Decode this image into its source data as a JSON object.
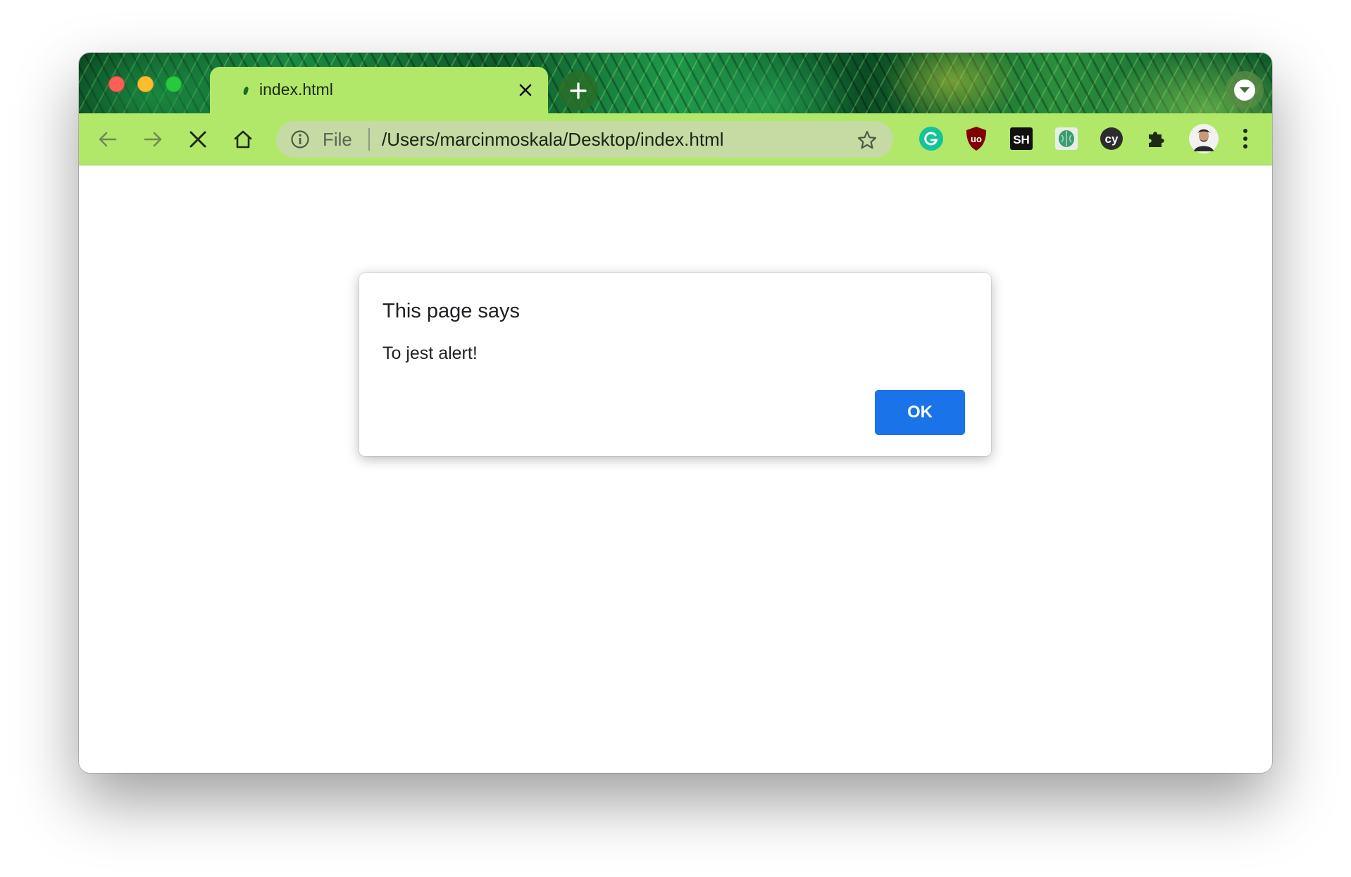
{
  "tab": {
    "title": "index.html",
    "favicon": "leaf-favicon-icon"
  },
  "toolbar": {
    "back_icon": "arrow-left-icon",
    "forward_icon": "arrow-right-icon",
    "stop_icon": "close-x-icon",
    "home_icon": "home-icon"
  },
  "omnibox": {
    "scheme_label": "File",
    "url": "/Users/marcinmoskala/Desktop/index.html",
    "info_icon": "info-icon",
    "bookmark_icon": "star-icon"
  },
  "extensions": [
    {
      "name": "grammarly",
      "icon": "grammarly-icon",
      "label": "G"
    },
    {
      "name": "ublock",
      "icon": "ublock-shield-icon",
      "label": "uo"
    },
    {
      "name": "sh",
      "icon": "sh-icon",
      "label": "SH"
    },
    {
      "name": "brain",
      "icon": "brain-icon",
      "label": ""
    },
    {
      "name": "cypress",
      "icon": "cypress-icon",
      "label": "cy"
    },
    {
      "name": "extensions",
      "icon": "puzzle-icon",
      "label": ""
    }
  ],
  "dialog": {
    "title": "This page says",
    "message": "To jest alert!",
    "ok_label": "OK"
  },
  "colors": {
    "tab_active": "#b1e869",
    "toolbar": "#b1e869",
    "omnibox": "#c5dba3",
    "ok_button": "#1a73e8",
    "traffic_close": "#fe5f57",
    "traffic_min": "#febc2e",
    "traffic_max": "#28c840"
  }
}
